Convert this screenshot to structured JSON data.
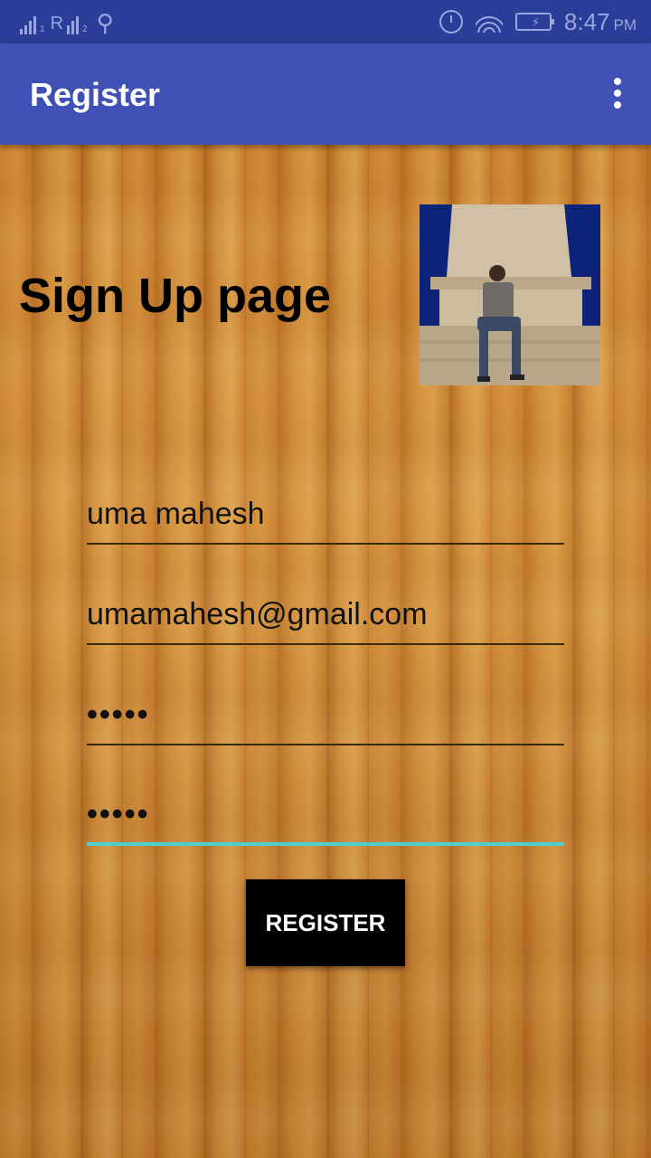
{
  "status_bar": {
    "sim1_label": "1",
    "sim2_label": "2",
    "network_label": "R",
    "time": "8:47",
    "ampm": "PM",
    "battery_glyph": "⚡"
  },
  "app_bar": {
    "title": "Register",
    "overflow_icon": "more-vert-icon"
  },
  "form": {
    "heading": "Sign Up page",
    "name_value": "uma mahesh",
    "email_value": "umamahesh@gmail.com",
    "password_value": "•••••",
    "confirm_password_value": "•••••",
    "register_label": "REGISTER"
  },
  "colors": {
    "status_bar": "#2c3d99",
    "app_bar": "#3f51b5",
    "focus_underline": "#4dd0d0",
    "button": "#000000"
  }
}
